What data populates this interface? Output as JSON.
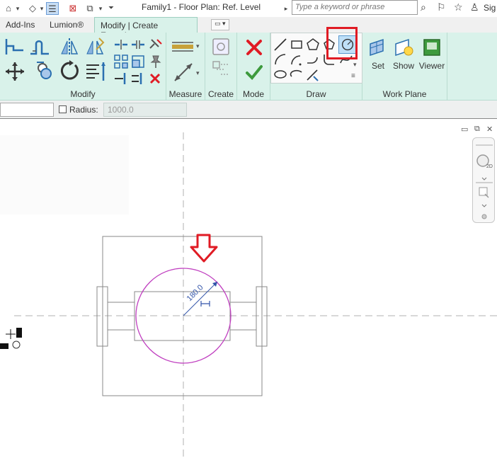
{
  "window": {
    "title": "Family1 - Floor Plan: Ref. Level",
    "search_placeholder": "Type a keyword or phrase",
    "user_label": "Sig"
  },
  "tabs": [
    {
      "label": "Add-Ins",
      "active": false
    },
    {
      "label": "Lumion®",
      "active": false
    },
    {
      "label": "Modify | Create Extrusion",
      "active": true
    }
  ],
  "ribbon": {
    "panels": {
      "modify": "Modify",
      "measure": "Measure",
      "create": "Create",
      "mode": "Mode",
      "draw": "Draw",
      "work_plane": "Work Plane"
    },
    "work_plane_buttons": {
      "set": "Set",
      "show": "Show",
      "viewer": "Viewer"
    }
  },
  "options_bar": {
    "radius_label": "Radius:",
    "radius_value": "1000.0",
    "radius_checked": false
  },
  "canvas": {
    "dimension_label": "180.0",
    "accent_red": "#e01b24",
    "circle_color": "#c040c0",
    "dimension_color": "#3355aa"
  }
}
